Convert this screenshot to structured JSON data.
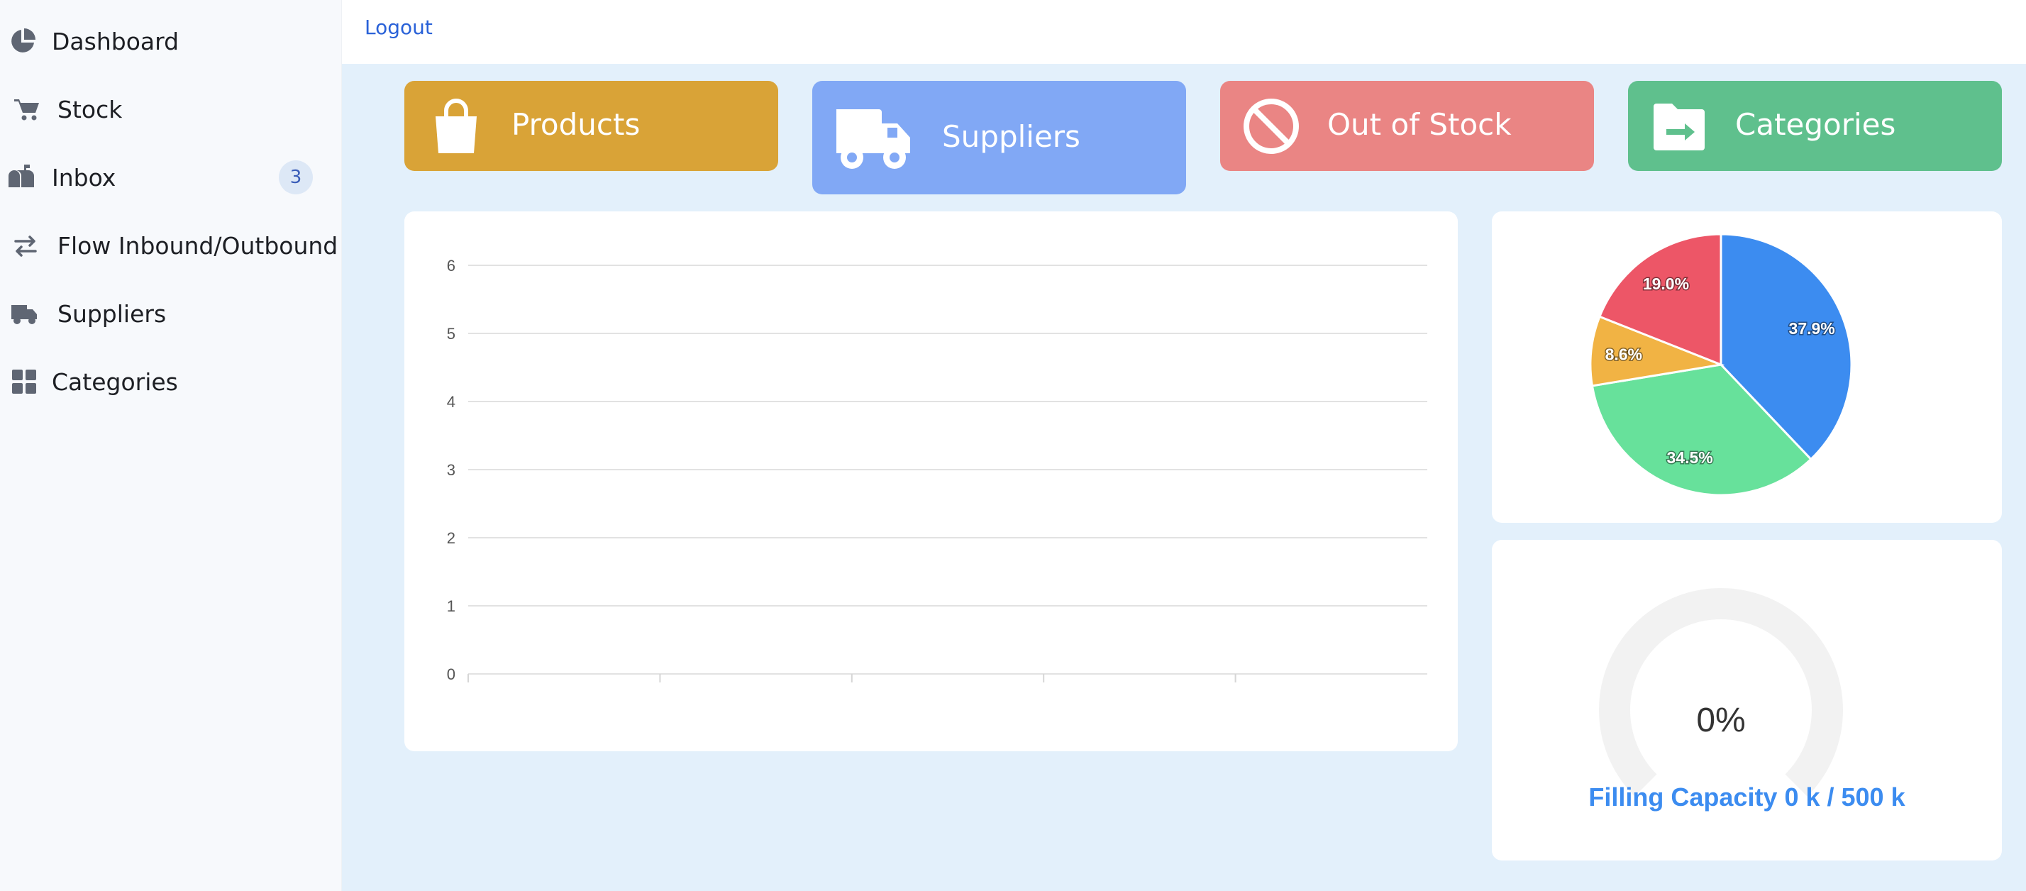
{
  "sidebar": {
    "items": [
      {
        "label": "Dashboard",
        "icon": "pie-chart-icon"
      },
      {
        "label": "Stock",
        "icon": "cart-icon"
      },
      {
        "label": "Inbox",
        "icon": "mailbox-icon",
        "badge": "3"
      },
      {
        "label": "Flow Inbound/Outbound",
        "icon": "exchange-arrows-icon"
      },
      {
        "label": "Suppliers",
        "icon": "truck-icon"
      },
      {
        "label": "Categories",
        "icon": "grid-icon"
      }
    ]
  },
  "topbar": {
    "logout_label": "Logout"
  },
  "cards": [
    {
      "label": "Products",
      "icon": "shopping-bag-icon",
      "color": "#d9a337"
    },
    {
      "label": "Suppliers",
      "icon": "truck-icon",
      "color": "#81a8f5"
    },
    {
      "label": "Out of Stock",
      "icon": "ban-icon",
      "color": "#ea8584"
    },
    {
      "label": "Categories",
      "icon": "folder-arrow-icon",
      "color": "#5fc08d"
    }
  ],
  "chart_data": [
    {
      "type": "bar",
      "categories": [
        "",
        "",
        "",
        "",
        ""
      ],
      "values": [],
      "ylim": [
        0,
        6
      ],
      "yticks": [
        0,
        1,
        2,
        3,
        4,
        5,
        6
      ],
      "grid": true,
      "xlabel": "",
      "ylabel": ""
    },
    {
      "type": "pie",
      "slices": [
        {
          "label": "37.9%",
          "value": 37.9,
          "color": "#3c8cf0"
        },
        {
          "label": "34.5%",
          "value": 34.5,
          "color": "#67e19b"
        },
        {
          "label": "8.6%",
          "value": 8.6,
          "color": "#f1b344"
        },
        {
          "label": "19.0%",
          "value": 19.0,
          "color": "#ed5667"
        }
      ]
    }
  ],
  "gauge": {
    "value_text": "0%",
    "value": 0,
    "caption": "Filling Capacity 0 k / 500 k",
    "color": "#3c8cf0",
    "track_color": "#f2f2f2"
  }
}
